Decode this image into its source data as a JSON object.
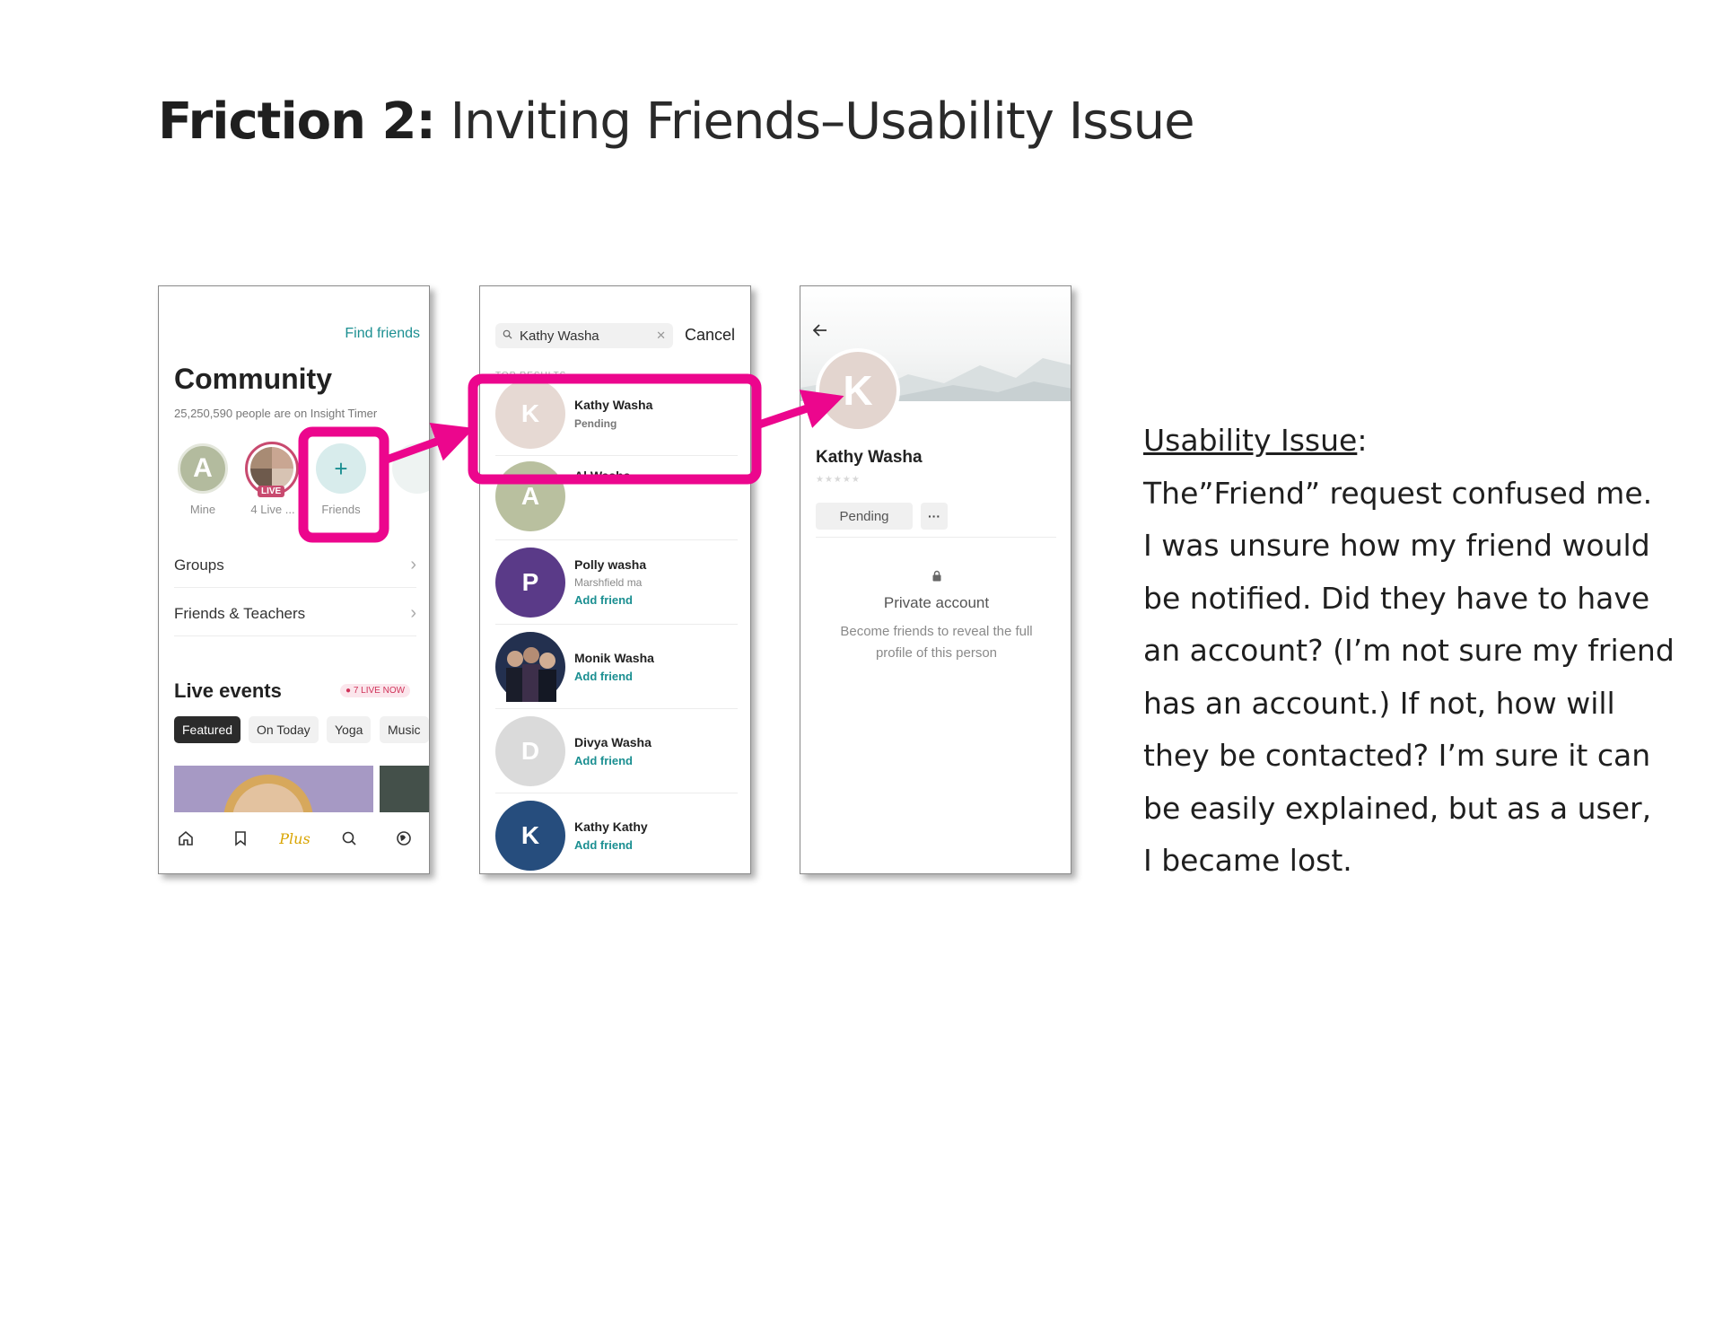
{
  "slide": {
    "title_bold": "Friction 2:",
    "title_light": "Inviting Friends–Usability Issue"
  },
  "screen_community": {
    "find_friends": "Find friends",
    "title": "Community",
    "subtitle": "25,250,590 people are on Insight Timer",
    "stories": [
      {
        "initial": "A",
        "caption": "Mine"
      },
      {
        "badge": "LIVE",
        "caption": "4 Live ..."
      },
      {
        "icon": "+",
        "caption": "Friends"
      }
    ],
    "rows": [
      {
        "label": "Groups"
      },
      {
        "label": "Friends & Teachers"
      }
    ],
    "live_events": {
      "title": "Live events",
      "badge": "7 LIVE NOW",
      "chips": [
        "Featured",
        "On Today",
        "Yoga",
        "Music"
      ]
    },
    "tabbar": {
      "plus_label": "Plus"
    }
  },
  "screen_search": {
    "query": "Kathy Washa",
    "cancel": "Cancel",
    "section_label": "TOP RESULTS",
    "results": [
      {
        "initial": "K",
        "name": "Kathy Washa",
        "status": "Pending"
      },
      {
        "initial": "A",
        "name": "Al Washa"
      },
      {
        "initial": "P",
        "name": "Polly washa",
        "location": "Marshfield ma",
        "action": "Add friend"
      },
      {
        "initial": "",
        "name": "Monik Washa",
        "action": "Add friend"
      },
      {
        "initial": "D",
        "name": "Divya Washa",
        "action": "Add friend"
      },
      {
        "initial": "K",
        "name": "Kathy Kathy",
        "action": "Add friend"
      }
    ]
  },
  "screen_profile": {
    "initial": "K",
    "name": "Kathy Washa",
    "stars": "★★★★★",
    "pending": "Pending",
    "more": "···",
    "private_title": "Private account",
    "private_desc": "Become friends to reveal the full profile of this person"
  },
  "issue": {
    "heading": "Usability Issue",
    "heading_suffix": ":",
    "lines": [
      "The”Friend” request confused me.",
      "I was unsure how my friend would",
      "be notified. Did they have to have",
      "an account? (I’m not sure my friend",
      "has an account.) If not, how will",
      "they be contacted? I’m sure it can",
      "be easily explained, but as a user,",
      "I became lost."
    ]
  },
  "colors": {
    "highlight": "#ec068d",
    "accent_teal": "#1b8f91",
    "live_red": "#c84a6f"
  }
}
